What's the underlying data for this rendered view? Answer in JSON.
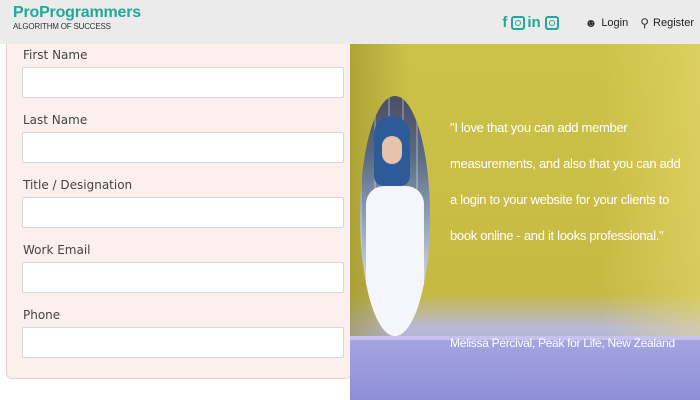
{
  "brand": {
    "name": "ProProgrammers",
    "tagline": "ALGORITHM OF SUCCESS"
  },
  "header": {
    "social_icons": [
      "facebook-icon",
      "instagram-icon",
      "linkedin-icon",
      "whatsapp-icon"
    ],
    "login_label": "Login",
    "register_label": "Register"
  },
  "form": {
    "fields": [
      {
        "label": "First Name",
        "value": ""
      },
      {
        "label": "Last Name",
        "value": ""
      },
      {
        "label": "Title / Designation",
        "value": ""
      },
      {
        "label": "Work Email",
        "value": ""
      },
      {
        "label": "Phone",
        "value": ""
      }
    ]
  },
  "testimonial": {
    "quote": "\"I love that you can add member measurements, and also that you can add a login to your website for your clients to book online - and it looks professional.\"",
    "author": "Melissa Percival, Peak for Life, New Zealand"
  },
  "colors": {
    "brand": "#20a89a",
    "form_bg": "#fcf0ee",
    "header_bg": "#ebebeb"
  }
}
